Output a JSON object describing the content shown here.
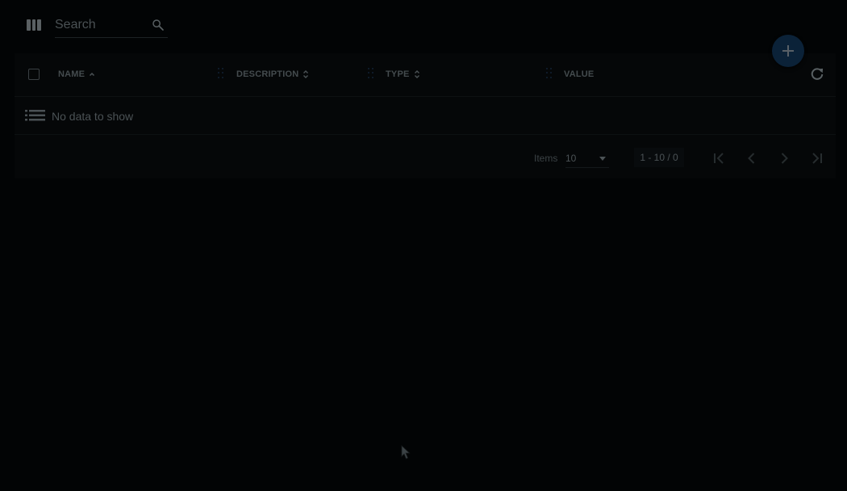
{
  "toolbar": {
    "columns_icon": "view-column-icon",
    "search_placeholder": "Search",
    "search_value": "",
    "search_icon": "search-icon",
    "add_icon": "plus-icon"
  },
  "table": {
    "columns": [
      {
        "label": "NAME",
        "sort": "ascending"
      },
      {
        "label": "DESCRIPTION",
        "sort": "unsorted"
      },
      {
        "label": "TYPE",
        "sort": "unsorted"
      },
      {
        "label": "VALUE",
        "sort": "none"
      }
    ],
    "refresh_icon": "refresh-icon",
    "empty_icon": "list-icon",
    "empty_text": "No data to show"
  },
  "pagination": {
    "items_label": "Items",
    "page_size": "10",
    "range": "1 - 10 / 0",
    "first_icon": "first-page-icon",
    "prev_icon": "chevron-left-icon",
    "next_icon": "chevron-right-icon",
    "last_icon": "last-page-icon"
  },
  "colors": {
    "background": "#020405",
    "card": "#050708",
    "fab": "#0b2238",
    "text": "#444b4e"
  }
}
